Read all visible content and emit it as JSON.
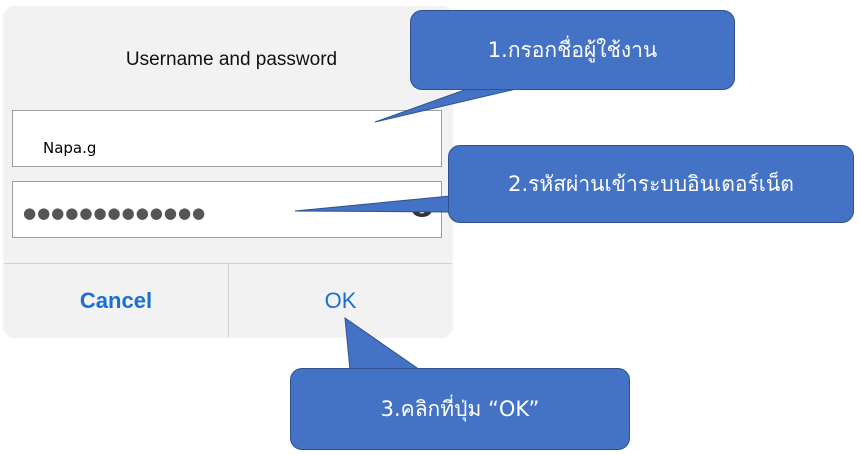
{
  "dialog": {
    "title": "Username and password",
    "username_value": "Napa.g",
    "password_masked": "●●●●●●●●●●●●●",
    "cancel_label": "Cancel",
    "ok_label": "OK",
    "eye_icon": "eye-icon"
  },
  "callouts": {
    "step1": "1.กรอกชื่อผู้ใช้งาน",
    "step2": "2.รหัสผ่านเข้าระบบอินเตอร์เน็ต",
    "step3": "3.คลิกที่ปุ่ม “OK”"
  },
  "colors": {
    "callout_fill": "#4472c4",
    "button_text": "#1a6fd4"
  }
}
